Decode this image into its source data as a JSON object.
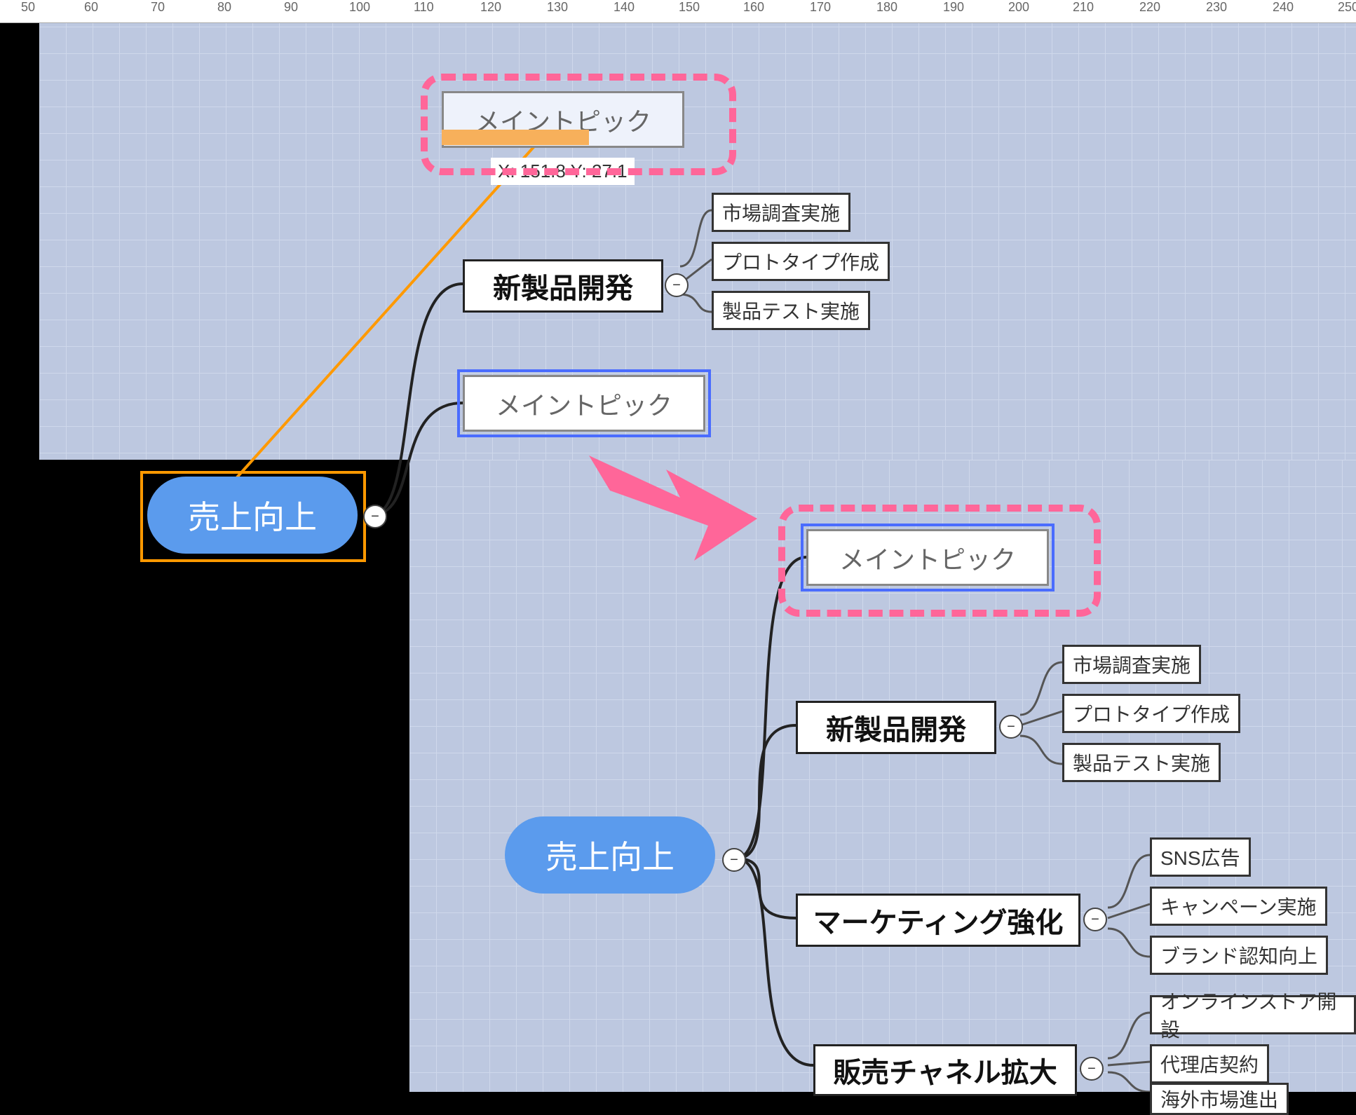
{
  "ruler": {
    "start": 50,
    "step": 10,
    "count": 21
  },
  "top": {
    "root": "売上向上",
    "coord": "X: 151.8 Y: 27.1",
    "main_topic_ghost": "メイントピック",
    "main_topic": "メイントピック",
    "branch1": {
      "label": "新製品開発",
      "children": [
        "市場調査実施",
        "プロトタイプ作成",
        "製品テスト実施"
      ]
    }
  },
  "bottom": {
    "root": "売上向上",
    "main_topic": "メイントピック",
    "branch1": {
      "label": "新製品開発",
      "children": [
        "市場調査実施",
        "プロトタイプ作成",
        "製品テスト実施"
      ]
    },
    "branch2": {
      "label": "マーケティング強化",
      "children": [
        "SNS広告",
        "キャンペーン実施",
        "ブランド認知向上"
      ]
    },
    "branch3": {
      "label": "販売チャネル拡大",
      "children": [
        "オンラインストア開設",
        "代理店契約",
        "海外市場進出"
      ]
    }
  },
  "glyph": {
    "minus": "−"
  }
}
